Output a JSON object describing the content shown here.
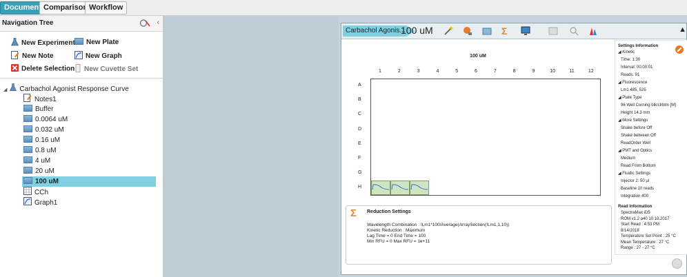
{
  "top_tabs": [
    "Document",
    "Comparison",
    "Workflow"
  ],
  "nav": {
    "title": "Navigation Tree",
    "actions": {
      "new_experiment": "New Experiment",
      "new_plate": "New Plate",
      "new_note": "New Note",
      "new_graph": "New Graph",
      "delete_selection": "Delete Selection",
      "new_cuvette_set": "New Cuvette Set"
    },
    "tree_root": "Carbachol Agonist Response Curve",
    "tree_items": [
      "Notes1",
      "Buffer",
      "0.0064 uM",
      "0.032 uM",
      "0.16 uM",
      "0.8 uM",
      "4 uM",
      "20 uM",
      "100 uM",
      "CCh",
      "Graph1"
    ],
    "selected_item": "100 uM"
  },
  "document": {
    "tab_label": "Carbachol Agonis...",
    "concentration": "100 uM",
    "plate_title": "100 uM",
    "columns": [
      "1",
      "2",
      "3",
      "4",
      "5",
      "6",
      "7",
      "8",
      "9",
      "10",
      "11",
      "12"
    ],
    "rows": [
      "A",
      "B",
      "C",
      "D",
      "E",
      "F",
      "G",
      "H"
    ]
  },
  "reduction": {
    "title": "Reduction Settings",
    "lines": [
      "Wavelength Combination : !Lm1*100/Average(ArraySection(!Lm1,1,10))",
      "Kinetic Reduction : Maximum",
      "Lag Time = 0 End Time = 100",
      "Min RFU = 0 Max RFU = 1e+11"
    ]
  },
  "settings_info": {
    "title": "Settings Information",
    "lines": [
      "◢ Kinetic",
      "Time:  1:30",
      "Interval:  00:00:01",
      "Reads:  91",
      "◢ Fluorescence",
      "Lm1    485, 525",
      "◢ Plate Type",
      "96 Well Corning blk/clrbtm [M]",
      "Height  14.3 mm",
      "◢ More Settings",
      "Shake before  Off",
      "Shake between  Off",
      "ReadOrder  Well",
      "◢ PMT and Optics",
      "Medium",
      "Read From Bottom",
      "◢ Fluidic Settings",
      "Injector 2:  50 µl",
      "Baseline  10 reads",
      "Integration  400"
    ],
    "read_title": "Read Information",
    "read_lines": [
      "SpectraMax iD5",
      "ROM v1.2 o40 10.10.2017",
      "Start Read : 4:53 PM",
      "8/14/2018",
      "Temperature Set Point : 25 °C",
      "Mean Temperature : 27 °C",
      "Range : 27 - 27 °C"
    ]
  },
  "colors": {
    "accent": "#3aa0b8",
    "selection": "#7fd0e3",
    "workspace": "#bfcdd4"
  }
}
